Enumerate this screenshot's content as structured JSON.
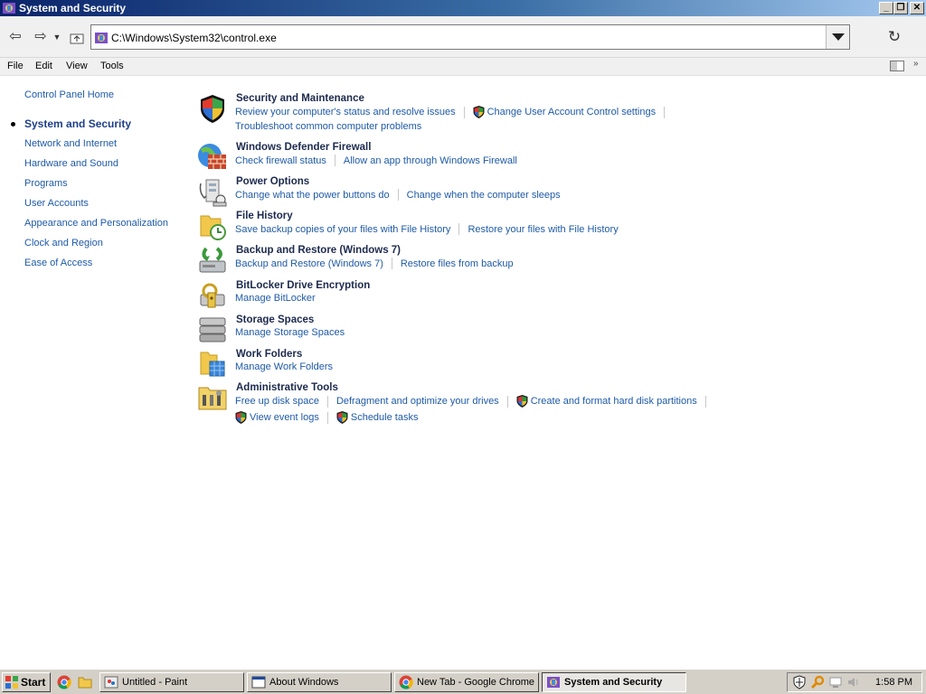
{
  "window": {
    "title": "System and Security"
  },
  "controls": {
    "minimize": "_",
    "restore": "❐",
    "close": "✕"
  },
  "address": {
    "path": "C:\\Windows\\System32\\control.exe"
  },
  "menu": [
    "File",
    "Edit",
    "View",
    "Tools"
  ],
  "sidebar": {
    "home": "Control Panel Home",
    "current": "System and Security",
    "items": [
      "Network and Internet",
      "Hardware and Sound",
      "Programs",
      "User Accounts",
      "Appearance and Personalization",
      "Clock and Region",
      "Ease of Access"
    ]
  },
  "categories": [
    {
      "title": "Security and Maintenance",
      "icon": "security-flag-icon",
      "rows": [
        [
          "Review your computer's status and resolve issues",
          "Change User Account Control settings"
        ],
        [
          "Troubleshoot common computer problems"
        ]
      ]
    },
    {
      "title": "Windows Defender Firewall",
      "icon": "firewall-icon",
      "rows": [
        [
          "Check firewall status",
          "Allow an app through Windows Firewall"
        ]
      ]
    },
    {
      "title": "Power Options",
      "icon": "power-options-icon",
      "rows": [
        [
          "Change what the power buttons do",
          "Change when the computer sleeps"
        ]
      ]
    },
    {
      "title": "File History",
      "icon": "file-history-icon",
      "rows": [
        [
          "Save backup copies of your files with File History",
          "Restore your files with File History"
        ]
      ]
    },
    {
      "title": "Backup and Restore (Windows 7)",
      "icon": "backup-restore-icon",
      "rows": [
        [
          "Backup and Restore (Windows 7)",
          "Restore files from backup"
        ]
      ]
    },
    {
      "title": "BitLocker Drive Encryption",
      "icon": "bitlocker-icon",
      "rows": [
        [
          "Manage BitLocker"
        ]
      ]
    },
    {
      "title": "Storage Spaces",
      "icon": "storage-spaces-icon",
      "rows": [
        [
          "Manage Storage Spaces"
        ]
      ]
    },
    {
      "title": "Work Folders",
      "icon": "work-folders-icon",
      "rows": [
        [
          "Manage Work Folders"
        ]
      ]
    },
    {
      "title": "Administrative Tools",
      "icon": "admin-tools-icon",
      "rows": [
        [
          "Free up disk space",
          "Defragment and optimize your drives",
          "Create and format hard disk partitions"
        ],
        [
          "View event logs",
          "Schedule tasks"
        ]
      ]
    }
  ],
  "taskbar": {
    "start": "Start",
    "items": [
      "Untitled - Paint",
      "About Windows",
      "New Tab - Google Chrome",
      "System and Security"
    ],
    "clock": "1:58 PM"
  },
  "colors": {
    "link": "#1e5aa8",
    "title_text": "#1c2a4e",
    "titlebar": "#0a246a"
  }
}
